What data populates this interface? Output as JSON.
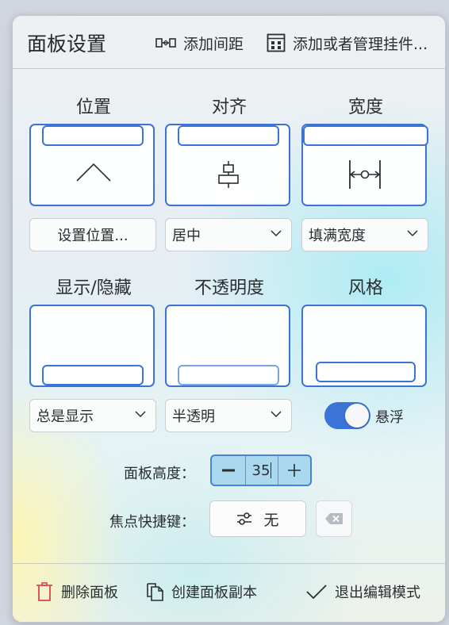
{
  "header": {
    "title": "面板设置",
    "add_spacer_label": "添加间距",
    "add_widgets_label": "添加或者管理挂件..."
  },
  "columns": {
    "position": {
      "label": "位置",
      "control_label": "设置位置..."
    },
    "alignment": {
      "label": "对齐",
      "selected": "居中"
    },
    "width": {
      "label": "宽度",
      "selected": "填满宽度"
    },
    "visibility": {
      "label": "显示/隐藏",
      "selected": "总是显示"
    },
    "opacity": {
      "label": "不透明度",
      "selected": "半透明"
    },
    "style": {
      "label": "风格",
      "toggle_label": "悬浮",
      "toggle_on": true
    }
  },
  "form": {
    "height_label": "面板高度：",
    "height_value": "35",
    "shortcut_label": "焦点快捷键：",
    "shortcut_value": "无"
  },
  "footer": {
    "delete_label": "删除面板",
    "clone_label": "创建面板副本",
    "exit_label": "退出编辑模式"
  },
  "colors": {
    "accent": "#3c73d6",
    "danger": "#da4453",
    "spin_bg": "#a9d8ef"
  }
}
